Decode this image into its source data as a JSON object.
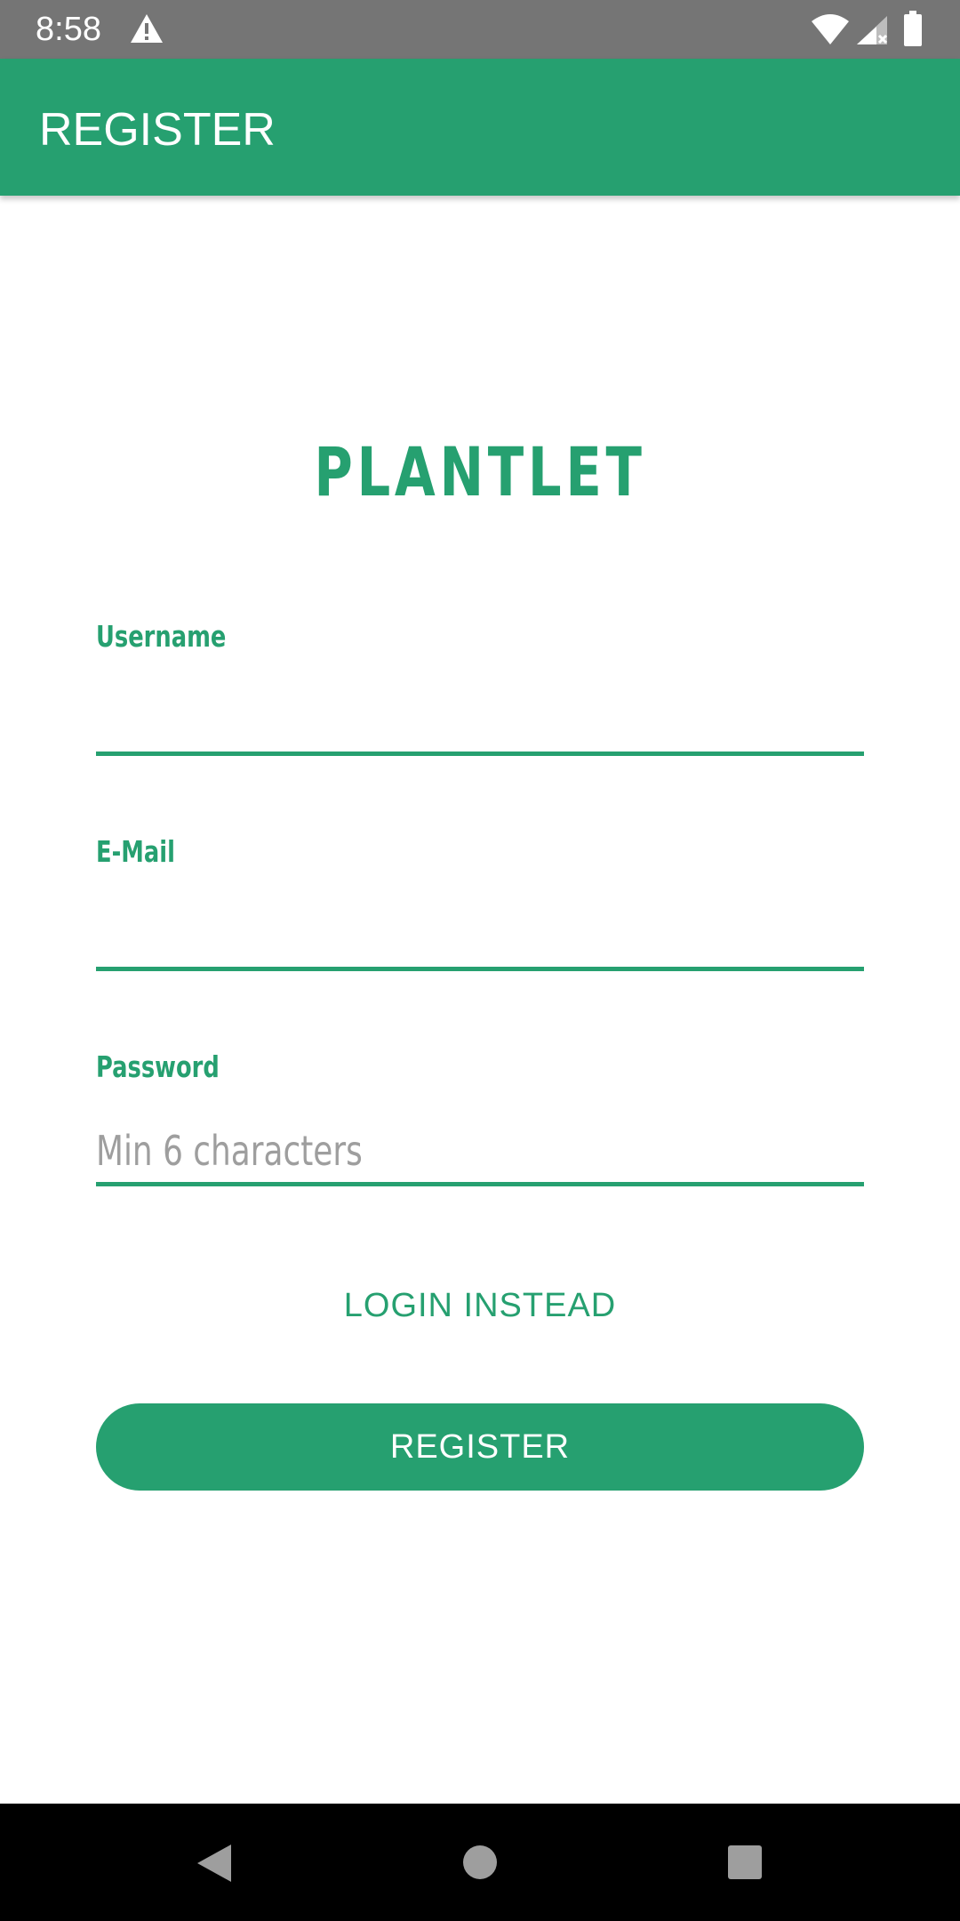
{
  "status_bar": {
    "time": "8:58"
  },
  "app_bar": {
    "title": "REGISTER"
  },
  "brand": {
    "name": "PLANTLET"
  },
  "form": {
    "username": {
      "label": "Username",
      "value": "",
      "placeholder": ""
    },
    "email": {
      "label": "E-Mail",
      "value": "",
      "placeholder": ""
    },
    "password": {
      "label": "Password",
      "value": "",
      "placeholder": "Min 6 characters"
    }
  },
  "actions": {
    "login_instead": "LOGIN INSTEAD",
    "register": "REGISTER"
  },
  "colors": {
    "primary": "#26a070",
    "status_bar": "#757575",
    "nav_bar": "#000000",
    "hint": "#9e9e9e"
  },
  "icons": {
    "status": [
      "warning-icon",
      "wifi-icon",
      "signal-icon",
      "battery-icon"
    ],
    "navigation": [
      "back-icon",
      "home-icon",
      "recents-icon"
    ]
  }
}
